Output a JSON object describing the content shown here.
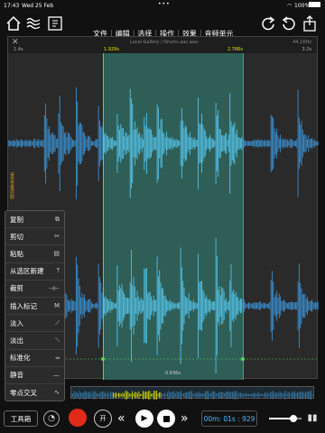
{
  "status": {
    "time": "17:43",
    "date": "Wed 25 Feb",
    "battery": "100%"
  },
  "menu": {
    "file": "文件",
    "edit": "编辑",
    "select": "选择",
    "operate": "操作",
    "effect": "效果",
    "unit": "音频单元"
  },
  "wave": {
    "filename": "Local Gallery / Drums.aac.wav",
    "sample_rate": "44.1KHz",
    "t_left": "1.4s",
    "t_sel_start": "1.929s",
    "t_sel_end": "2.766s",
    "t_right": "3.2s",
    "sel_len": "0.836s",
    "vlabel": "录音音量控制"
  },
  "context_menu": [
    {
      "label": "复制",
      "icon": "copy-icon",
      "glyph": "⧉"
    },
    {
      "label": "剪切",
      "icon": "scissors-icon",
      "glyph": "✂"
    },
    {
      "label": "粘贴",
      "icon": "paste-icon",
      "glyph": "▤"
    },
    {
      "label": "从选区新建",
      "icon": "new-from-selection-icon",
      "glyph": "⤒"
    },
    {
      "label": "裁剪",
      "icon": "trim-icon",
      "glyph": "⊣⊢"
    },
    {
      "label": "插入标记",
      "icon": "marker-icon",
      "glyph": "M"
    },
    {
      "label": "淡入",
      "icon": "fade-in-icon",
      "glyph": "⟋"
    },
    {
      "label": "淡出",
      "icon": "fade-out-icon",
      "glyph": "⟍"
    },
    {
      "label": "标准化",
      "icon": "normalize-icon",
      "glyph": "═"
    },
    {
      "label": "静音",
      "icon": "silence-icon",
      "glyph": "—"
    },
    {
      "label": "零点交叉",
      "icon": "zero-cross-icon",
      "glyph": "∿"
    }
  ],
  "toolbar": {
    "toolbox": "工具箱",
    "loop": "开",
    "time": "00m: 01s : 929",
    "volume_level": 0.75
  },
  "colors": {
    "wave": "#3a8fd0",
    "selection": "#2e5e56",
    "playhead": "#5cd65c",
    "record": "#e12a1a",
    "time_text": "#4fb8ff"
  }
}
